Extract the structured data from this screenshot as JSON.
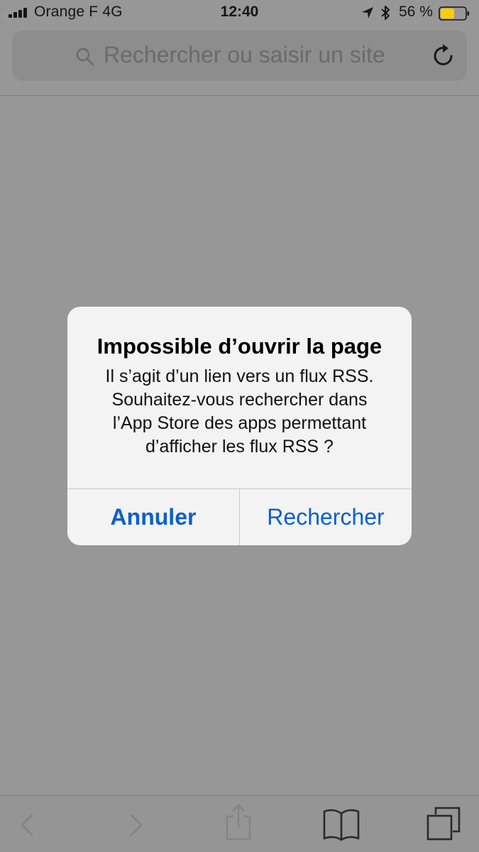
{
  "status_bar": {
    "carrier": "Orange F   4G",
    "time": "12:40",
    "battery_percent": "56 %",
    "battery_level": 0.56,
    "battery_color": "#ffcc00",
    "icons": [
      "signal-icon",
      "location-arrow-icon",
      "bluetooth-icon",
      "battery-icon"
    ]
  },
  "address_bar": {
    "placeholder": "Rechercher ou saisir un site",
    "icons": [
      "search-icon",
      "reload-icon"
    ]
  },
  "alert": {
    "title": "Impossible d’ouvrir la page",
    "message_lines": [
      "Il s’agit d’un lien vers un flux RSS.",
      "Souhaitez-vous rechercher dans",
      "l’App Store des apps permettant",
      "d’afficher les flux RSS ?"
    ],
    "cancel_label": "Annuler",
    "search_label": "Rechercher",
    "accent_color": "#0d60c8"
  },
  "toolbar": {
    "icons": [
      "back-chevron-icon",
      "forward-chevron-icon",
      "share-icon",
      "bookmarks-icon",
      "tabs-icon"
    ]
  }
}
